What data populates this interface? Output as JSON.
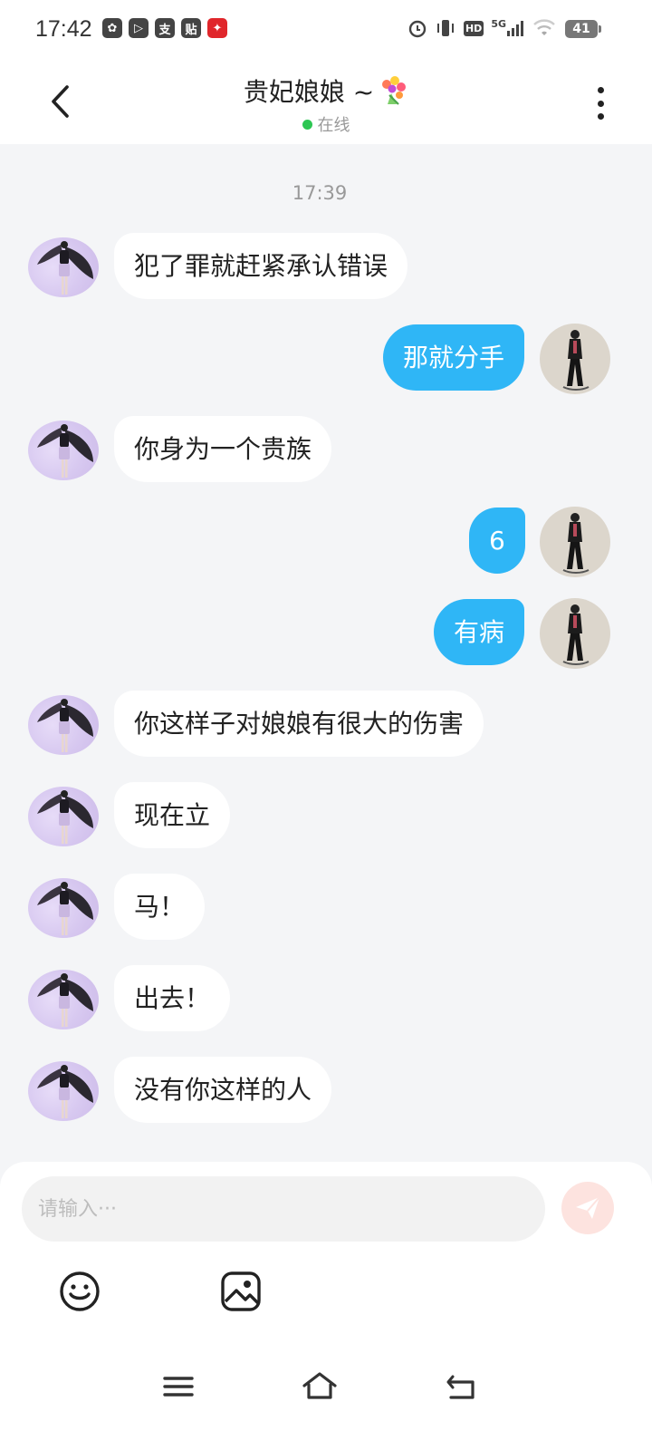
{
  "status_bar": {
    "time": "17:42",
    "app_icons": [
      "wechat-icon",
      "video-icon",
      "alipay-icon",
      "tieba-icon",
      "huawei-icon"
    ],
    "app_glyphs": [
      "✿",
      "▷",
      "支",
      "贴",
      "✦"
    ],
    "network": "5G",
    "hd_label": "HD",
    "battery": "41"
  },
  "header": {
    "title": "贵妃娘娘 ~",
    "emoji_icon": "bouquet-icon",
    "status_text": "在线",
    "status_color": "#2dc653"
  },
  "messages": {
    "timestamp": "17:39",
    "items": [
      {
        "side": "in",
        "text": "犯了罪就赶紧承认错误"
      },
      {
        "side": "out",
        "text": "那就分手"
      },
      {
        "side": "in",
        "text": "你身为一个贵族"
      },
      {
        "side": "out",
        "text": "6"
      },
      {
        "side": "out",
        "text": "有病"
      },
      {
        "side": "in",
        "text": "你这样子对娘娘有很大的伤害"
      },
      {
        "side": "in",
        "text": "现在立"
      },
      {
        "side": "in",
        "text": "马！"
      },
      {
        "side": "in",
        "text": "出去！"
      },
      {
        "side": "in",
        "text": "没有你这样的人"
      }
    ]
  },
  "composer": {
    "placeholder": "请输入···",
    "value": ""
  },
  "colors": {
    "outgoing_bubble": "#2fb6f6",
    "incoming_bubble": "#ffffff",
    "background": "#f4f5f7",
    "send_button": "#fde3df"
  }
}
